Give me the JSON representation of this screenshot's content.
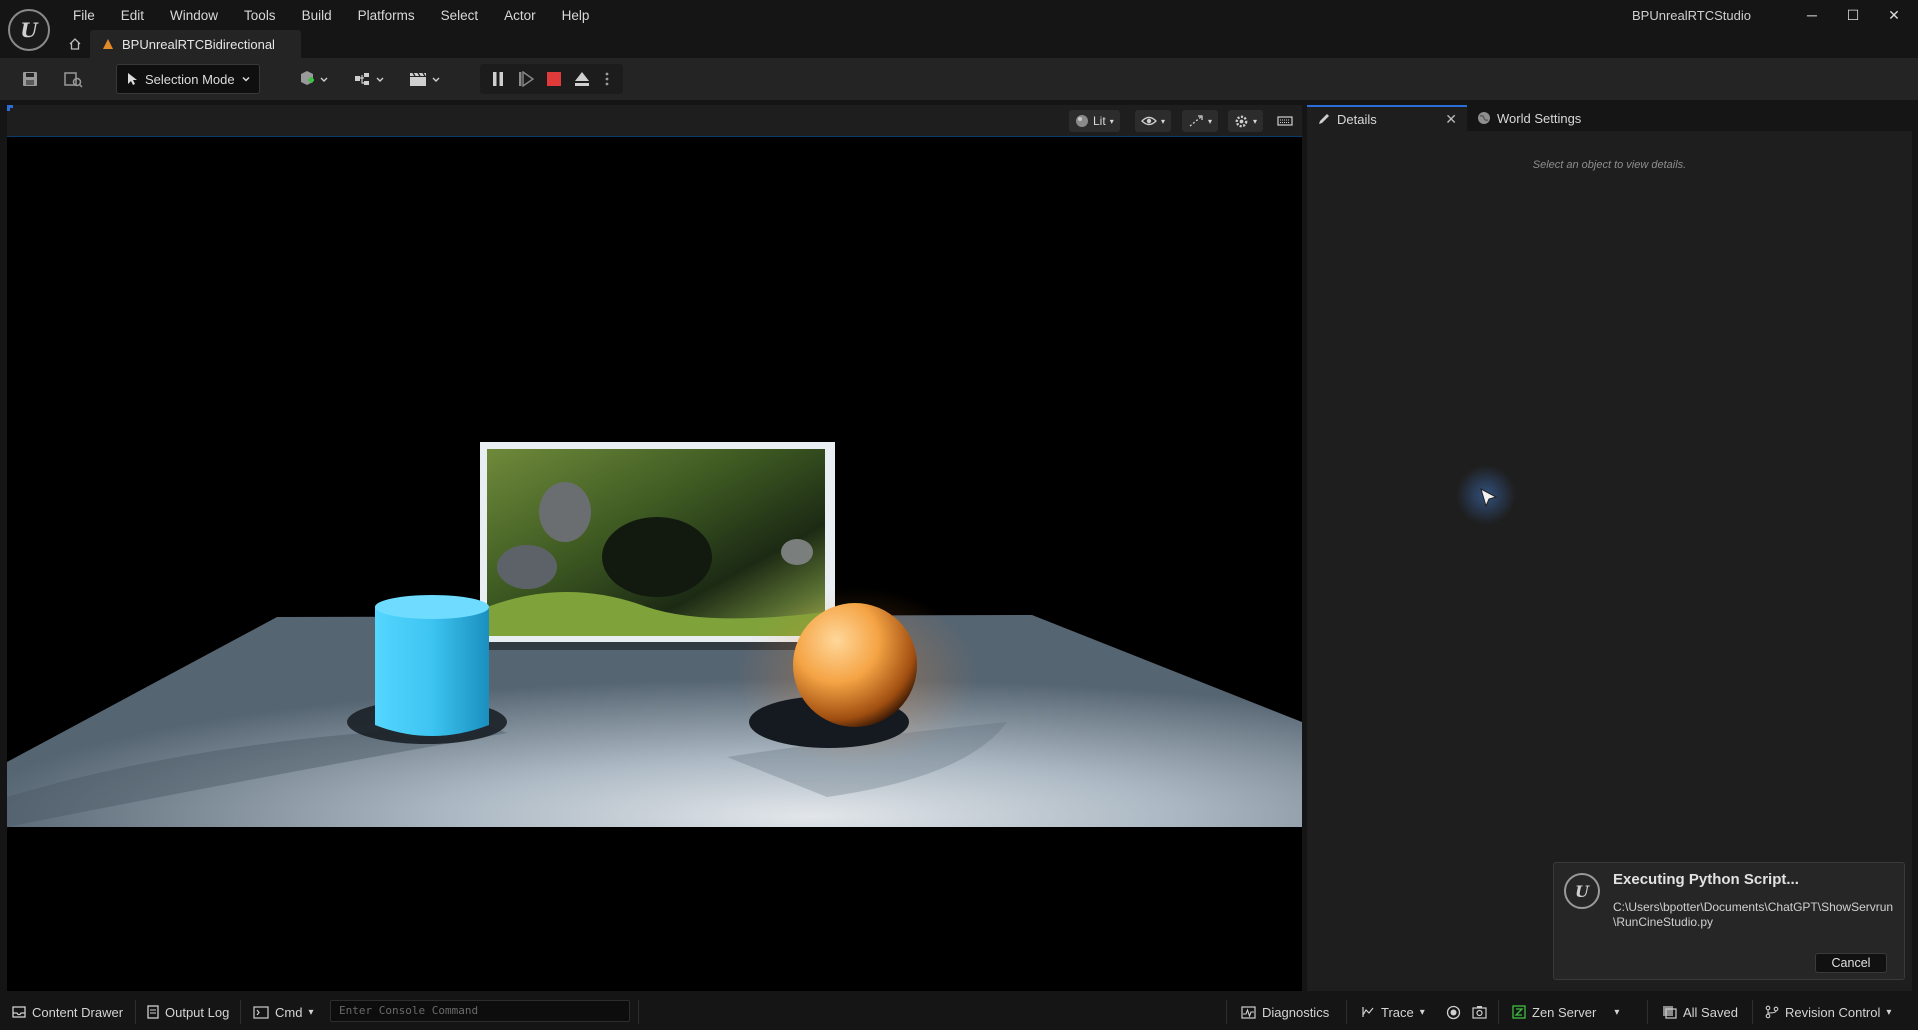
{
  "app": {
    "window_title": "BPUnrealRTCStudio",
    "document_tab": "BPUnrealRTCBidirectional"
  },
  "menu": [
    "File",
    "Edit",
    "Window",
    "Tools",
    "Build",
    "Platforms",
    "Select",
    "Actor",
    "Help"
  ],
  "toolbar": {
    "selection_mode": "Selection Mode"
  },
  "viewport": {
    "view_mode": "Lit"
  },
  "details_panel": {
    "tab_details": "Details",
    "tab_world_settings": "World Settings",
    "empty_message": "Select an object to view details."
  },
  "notification": {
    "title": "Executing Python Script...",
    "path": "C:\\Users\\bpotter\\Documents\\ChatGPT\\ShowServrun\\RunCineStudio.py",
    "cancel_label": "Cancel"
  },
  "statusbar": {
    "content_drawer": "Content Drawer",
    "output_log": "Output Log",
    "cmd": "Cmd",
    "console_placeholder": "Enter Console Command",
    "diagnostics": "Diagnostics",
    "trace": "Trace",
    "zen_server": "Zen Server",
    "all_saved": "All Saved",
    "revision_control": "Revision Control"
  },
  "colors": {
    "accent_blue": "#2a6fd6",
    "stop_red": "#e03a3a",
    "cylinder": "#3ec6f0",
    "sphere": "#f2a04a"
  }
}
